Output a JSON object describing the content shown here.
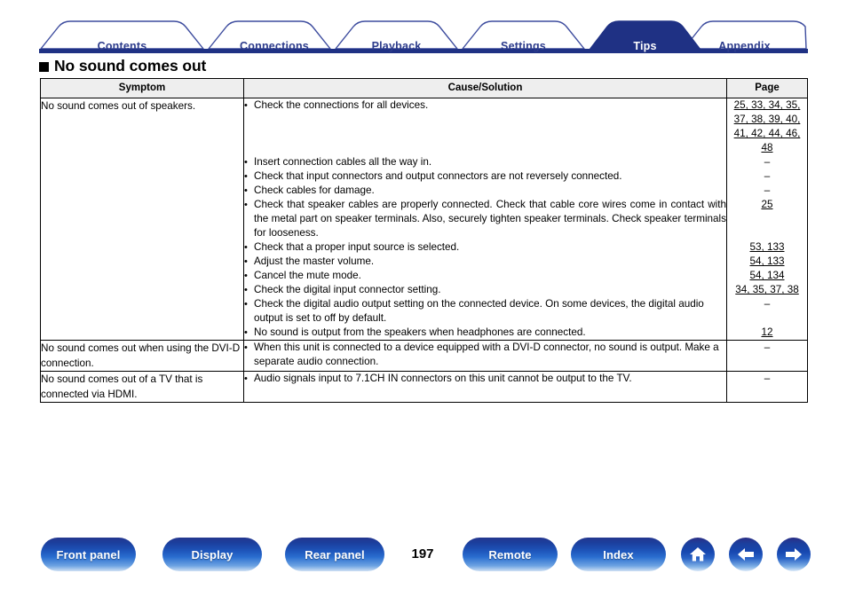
{
  "tabs": [
    {
      "label": "Contents",
      "active": false
    },
    {
      "label": "Connections",
      "active": false
    },
    {
      "label": "Playback",
      "active": false
    },
    {
      "label": "Settings",
      "active": false
    },
    {
      "label": "Tips",
      "active": true
    },
    {
      "label": "Appendix",
      "active": false
    }
  ],
  "section": {
    "title": "No sound comes out"
  },
  "table": {
    "headers": {
      "symptom": "Symptom",
      "cause": "Cause/Solution",
      "page": "Page"
    },
    "rows": [
      {
        "symptom": "No sound comes out of speakers.",
        "items": [
          {
            "text": "Check the connections for all devices.",
            "pages": [
              "25, 33, 34, 35,",
              "37, 38, 39, 40,",
              "41, 42, 44, 46,",
              "48"
            ]
          },
          {
            "text": "Insert connection cables all the way in.",
            "pages": [
              "–"
            ]
          },
          {
            "text": "Check that input connectors and output connectors are not reversely connected.",
            "pages": [
              "–"
            ]
          },
          {
            "text": "Check cables for damage.",
            "pages": [
              "–"
            ]
          },
          {
            "text": "Check that speaker cables are properly connected. Check that cable core wires come in contact with the metal part on speaker terminals. Also, securely tighten speaker terminals. Check speaker terminals for looseness.",
            "pages": [
              "25"
            ]
          },
          {
            "text": "Check that a proper input source is selected.",
            "pages": [
              "53, 133"
            ]
          },
          {
            "text": "Adjust the master volume.",
            "pages": [
              "54, 133"
            ]
          },
          {
            "text": "Cancel the mute mode.",
            "pages": [
              "54, 134"
            ]
          },
          {
            "text": "Check the digital input connector setting.",
            "pages": [
              "34, 35, 37, 38"
            ]
          },
          {
            "text": "Check the digital audio output setting on the connected device. On some devices, the digital audio output is set to off by default.",
            "pages": [
              "–"
            ]
          },
          {
            "text": "No sound is output from the speakers when headphones are connected.",
            "pages": [
              "12"
            ]
          }
        ]
      },
      {
        "symptom": "No sound comes out when using the DVI-D connection.",
        "items": [
          {
            "text": "When this unit is connected to a device equipped with a DVI-D connector, no sound is output. Make a separate audio connection.",
            "pages": [
              "–"
            ]
          }
        ]
      },
      {
        "symptom": "No sound comes out of a TV that is connected via HDMI.",
        "items": [
          {
            "text": "Audio signals input to 7.1CH IN connectors on this unit cannot be output to the TV.",
            "pages": [
              "–"
            ]
          }
        ]
      }
    ]
  },
  "footer": {
    "buttons": [
      {
        "label": "Front panel",
        "icon": ""
      },
      {
        "label": "Display",
        "icon": ""
      },
      {
        "label": "Rear panel",
        "icon": ""
      },
      {
        "label": "Remote",
        "icon": ""
      },
      {
        "label": "Index",
        "icon": ""
      }
    ],
    "page_number": "197",
    "icons": [
      "home-icon",
      "arrow-left-icon",
      "arrow-right-icon"
    ]
  },
  "colors": {
    "tab_active_bg": "#1f3184",
    "tab_text": "#2d3c8c",
    "header_row_bg": "#eeeeee",
    "button_blue": "#1b3f9e"
  }
}
